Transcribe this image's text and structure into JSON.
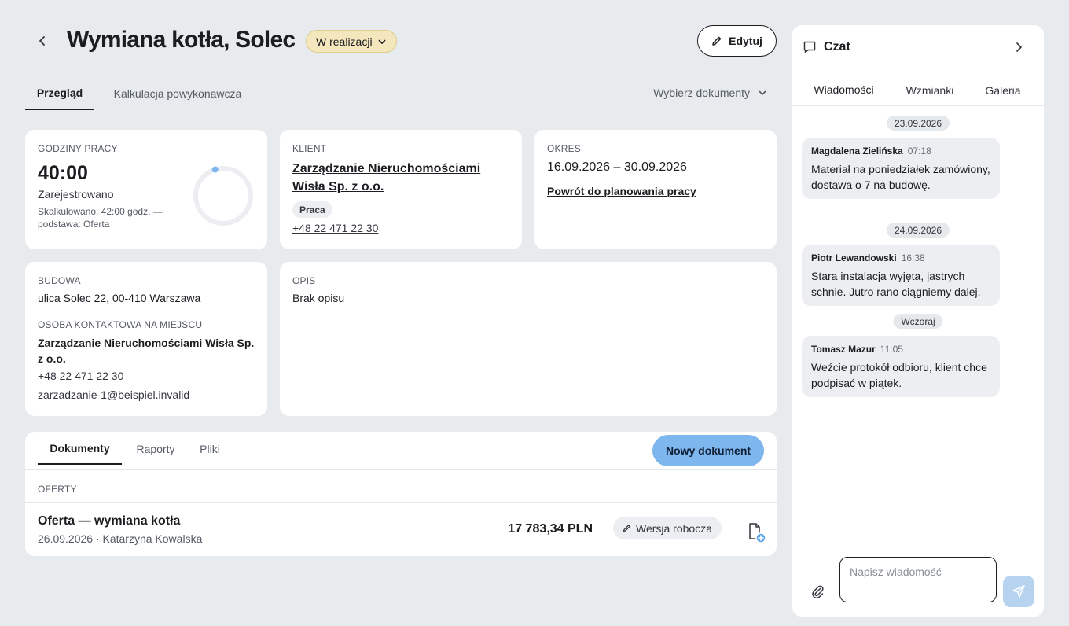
{
  "header": {
    "title": "Wymiana kotła, Solec",
    "status": "W realizacji",
    "edit_label": "Edytuj"
  },
  "main_tabs": [
    {
      "label": "Przegląd",
      "active": true
    },
    {
      "label": "Kalkulacja powykonawcza",
      "active": false
    }
  ],
  "document_select": "Wybierz dokumenty",
  "hours": {
    "label": "GODZINY PRACY",
    "value": "40:00",
    "registered": "Zarejestrowano",
    "note": "Skalkulowano: 42:00 godz. — podstawa: Oferta",
    "logged": 40,
    "planned": 42
  },
  "client": {
    "label": "KLIENT",
    "name": "Zarządzanie Nieruchomościami Wisła Sp. z o.o.",
    "tag": "Praca",
    "phone": "+48 22 471 22 30"
  },
  "period": {
    "label": "OKRES",
    "value": "16.09.2026 – 30.09.2026",
    "link": "Powrót do planowania pracy"
  },
  "site": {
    "label": "BUDOWA",
    "address": "ulica Solec 22, 00-410 Warszawa",
    "contact_label": "OSOBA KONTAKTOWA NA MIEJSCU",
    "contact_name": "Zarządzanie Nieruchomościami Wisła Sp. z o.o.",
    "contact_phone": "+48 22 471 22 30",
    "contact_email": "zarzadzanie-1@beispiel.invalid"
  },
  "description": {
    "label": "OPIS",
    "text": "Brak opisu"
  },
  "documents": {
    "tabs": [
      {
        "label": "Dokumenty",
        "active": true
      },
      {
        "label": "Raporty",
        "active": false
      },
      {
        "label": "Pliki",
        "active": false
      }
    ],
    "new_label": "Nowy dokument",
    "section_label": "OFERTY",
    "offers": [
      {
        "title": "Oferta — wymiana kotła",
        "meta": "26.09.2026 · Katarzyna Kowalska",
        "amount": "17 783,34 PLN",
        "status": "Wersja robocza"
      }
    ]
  },
  "chat": {
    "title": "Czat",
    "tabs": [
      {
        "label": "Wiadomości",
        "active": true
      },
      {
        "label": "Wzmianki",
        "active": false
      },
      {
        "label": "Galeria",
        "active": false
      }
    ],
    "groups": [
      {
        "date": "23.09.2026",
        "messages": [
          {
            "author": "Magdalena Zielińska",
            "time": "07:18",
            "text": "Materiał na poniedziałek zamówiony, dostawa o 7 na budowę."
          }
        ]
      },
      {
        "date": "24.09.2026",
        "messages": [
          {
            "author": "Piotr Lewandowski",
            "time": "16:38",
            "text": "Stara instalacja wyjęta, jastrych schnie. Jutro rano ciągniemy dalej."
          }
        ]
      },
      {
        "date": "Wczoraj",
        "messages": [
          {
            "author": "Tomasz Mazur",
            "time": "11:05",
            "text": "Weźcie protokół odbioru, klient chce podpisać w piątek."
          }
        ]
      }
    ],
    "input_placeholder": "Napisz wiadomość"
  },
  "colors": {
    "accent": "#7eb6ee",
    "status_bg": "#f4e6bd",
    "page_bg": "#e8ebee"
  },
  "icons": {
    "back": "chevron-left-icon",
    "edit": "pencil-icon",
    "chat": "chat-bubble-icon",
    "collapse": "chevron-right-icon",
    "attach": "paperclip-icon",
    "send": "send-icon",
    "document_add": "document-add-icon"
  }
}
